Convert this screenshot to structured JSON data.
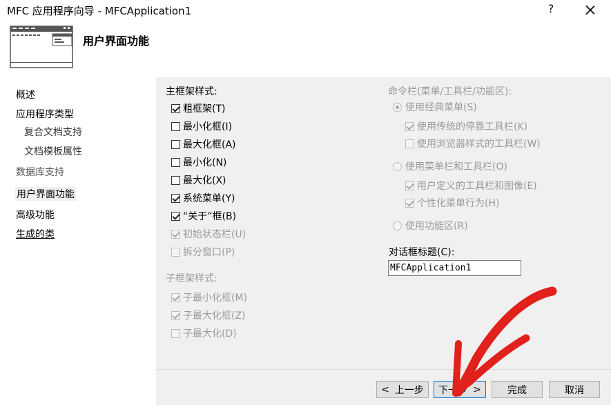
{
  "window": {
    "title": "MFC 应用程序向导 - MFCApplication1",
    "help_glyph": "?"
  },
  "header": {
    "title": "用户界面功能",
    "icon": "window-layout-icon"
  },
  "sidebar": {
    "items": [
      {
        "label": "概述"
      },
      {
        "label": "应用程序类型"
      },
      {
        "label": "复合文档支持"
      },
      {
        "label": "文档模板属性"
      },
      {
        "label": "数据库支持"
      },
      {
        "label": "用户界面功能"
      },
      {
        "label": "高级功能"
      },
      {
        "label": "生成的类"
      }
    ]
  },
  "main_frame": {
    "label": "主框架样式:",
    "options": [
      {
        "label": "粗框架(T)",
        "checked": true
      },
      {
        "label": "最小化框(I)",
        "checked": false
      },
      {
        "label": "最大化框(A)",
        "checked": false
      },
      {
        "label": "最小化(N)",
        "checked": false
      },
      {
        "label": "最大化(X)",
        "checked": false
      },
      {
        "label": "系统菜单(Y)",
        "checked": true
      },
      {
        "label": "“关于”框(B)",
        "checked": true
      },
      {
        "label": "初始状态栏(U)",
        "checked": true,
        "enabled": false
      },
      {
        "label": "拆分窗口(P)",
        "checked": false,
        "enabled": false
      }
    ]
  },
  "child_frame": {
    "label": "子框架样式:",
    "options": [
      {
        "label": "子最小化框(M)",
        "checked": true,
        "enabled": false
      },
      {
        "label": "子最大化框(Z)",
        "checked": true,
        "enabled": false
      },
      {
        "label": "子最大化(D)",
        "checked": false,
        "enabled": false
      }
    ]
  },
  "command_bar": {
    "label": "命令栏(菜单/工具栏/功能区):",
    "classic_menu": "使用经典菜单(S)",
    "classic_options": [
      {
        "label": "使用传统的停靠工具栏(K)",
        "checked": true
      },
      {
        "label": "使用浏览器样式的工具栏(W)",
        "checked": false
      }
    ],
    "menubar": "使用菜单栏和工具栏(O)",
    "menubar_options": [
      {
        "label": "用户定义的工具栏和图像(E)",
        "checked": true
      },
      {
        "label": "个性化菜单行为(H)",
        "checked": true
      }
    ],
    "ribbon": "使用功能区(R)"
  },
  "dialog_title": {
    "label": "对话框标题(C):",
    "value": "MFCApplication1"
  },
  "buttons": {
    "prev": "上一步",
    "prev_glyph": "<",
    "next": "下一步",
    "next_glyph": ">",
    "finish": "完成",
    "cancel": "取消"
  },
  "annotation": {
    "color": "#e0211c"
  }
}
